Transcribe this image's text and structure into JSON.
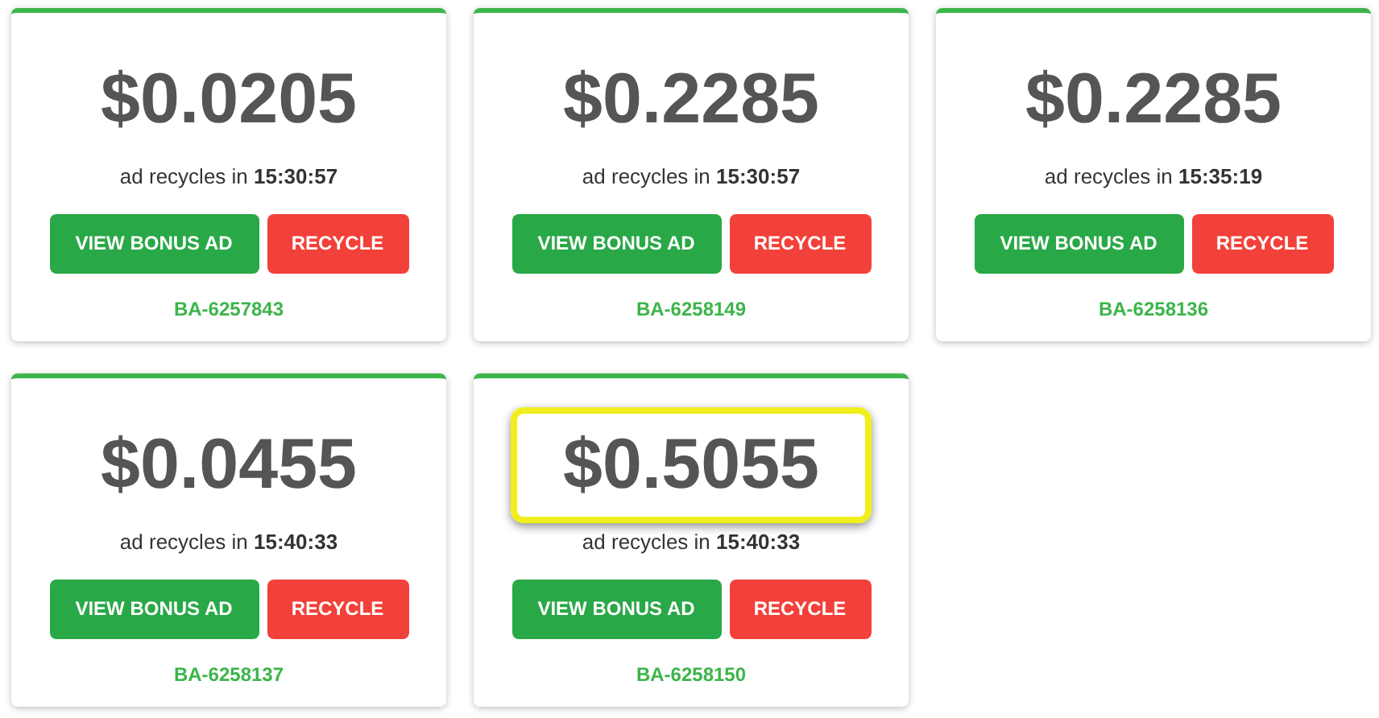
{
  "cards": [
    {
      "price": "$0.0205",
      "recycle_text": "ad recycles in **15:30:57**",
      "bonus_button": "VIEW BONUS AD",
      "recycle_button": "RECYCLE",
      "ad_id": "BA-6257843",
      "highlighted": false
    },
    {
      "price": "$0.2285",
      "recycle_text": "ad recycles in **15:30:57**",
      "bonus_button": "VIEW BONUS AD",
      "recycle_button": "RECYCLE",
      "ad_id": "BA-6258149",
      "highlighted": false
    },
    {
      "price": "$0.2285",
      "recycle_text": "ad recycles in **15:35:19**",
      "bonus_button": "VIEW BONUS AD",
      "recycle_button": "RECYCLE",
      "ad_id": "BA-6258136",
      "highlighted": false
    },
    {
      "price": "$0.0455",
      "recycle_text": "ad recycles in **15:40:33**",
      "bonus_button": "VIEW BONUS AD",
      "recycle_button": "RECYCLE",
      "ad_id": "BA-6258137",
      "highlighted": false
    },
    {
      "price": "$0.5055",
      "recycle_text": "ad recycles in **15:40:33**",
      "bonus_button": "VIEW BONUS AD",
      "recycle_button": "RECYCLE",
      "ad_id": "BA-6258150",
      "highlighted": true
    }
  ]
}
